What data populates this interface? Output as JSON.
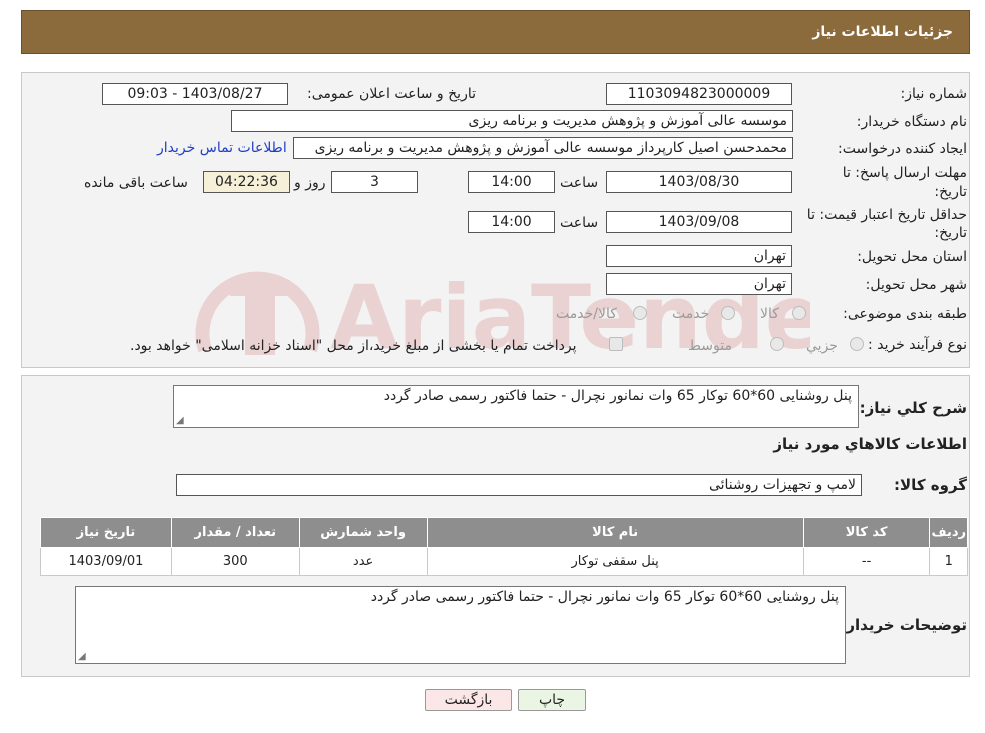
{
  "header": {
    "title": "جزئیات اطلاعات نیاز"
  },
  "watermark": {
    "text": "AriaTender.neT"
  },
  "form": {
    "need_number_label": "شماره نیاز:",
    "need_number": "1103094823000009",
    "announce_label": "تاریخ و ساعت اعلان عمومی:",
    "announce_value": "1403/08/27 - 09:03",
    "buyer_org_label": "نام دستگاه خریدار:",
    "buyer_org": "موسسه عالی آموزش و پژوهش مدیریت و برنامه ریزی",
    "creator_label": "ایجاد کننده درخواست:",
    "creator": "محمدحسن اصیل کارپرداز موسسه عالی آموزش و پژوهش مدیریت و برنامه ریزی",
    "contact_link": "اطلاعات تماس خریدار",
    "reply_deadline_label_1": "مهلت ارسال پاسخ: تا",
    "reply_deadline_label_2": "تاریخ:",
    "reply_date": "1403/08/30",
    "time_label": "ساعت",
    "reply_time": "14:00",
    "days_value": "3",
    "days_label": "روز و",
    "remaining_time": "04:22:36",
    "remaining_label": "ساعت باقی مانده",
    "price_valid_label_1": "حداقل تاریخ اعتبار قیمت: تا",
    "price_valid_label_2": "تاریخ:",
    "price_valid_date": "1403/09/08",
    "price_valid_time": "14:00",
    "province_label": "استان محل تحویل:",
    "province": "تهران",
    "city_label": "شهر محل تحویل:",
    "city": "تهران",
    "category_label": "طبقه بندی موضوعی:",
    "category_options": [
      "کالا",
      "خدمت",
      "کالا/خدمت"
    ],
    "process_label": "نوع فرآیند خرید :",
    "process_options": [
      "جزیي",
      "متوسط"
    ],
    "process_note": "پرداخت تمام یا بخشی از مبلغ خرید،از محل \"اسناد خزانه اسلامی\" خواهد بود."
  },
  "details": {
    "summary_label": "شرح کلي نياز:",
    "summary": "پنل روشنایی 60*60 توکار 65 وات نمانور نچرال - حتما فاکتور رسمی صادر گردد",
    "items_title": "اطلاعات کالاهاي مورد نياز",
    "group_label": "گروه کالا:",
    "group": "لامپ و تجهیزات روشنائی",
    "table": {
      "headers": [
        "ردیف",
        "کد کالا",
        "نام کالا",
        "واحد شمارش",
        "تعداد / مقدار",
        "تاریخ نیاز"
      ],
      "rows": [
        [
          "1",
          "--",
          "پنل سقفی توکار",
          "عدد",
          "300",
          "1403/09/01"
        ]
      ]
    },
    "buyer_notes_label": "توضیحات خریدار:",
    "buyer_notes": "پنل روشنایی 60*60 توکار 65 وات نمانور نچرال - حتما فاکتور رسمی صادر گردد"
  },
  "buttons": {
    "print": "چاپ",
    "back": "بازگشت"
  }
}
